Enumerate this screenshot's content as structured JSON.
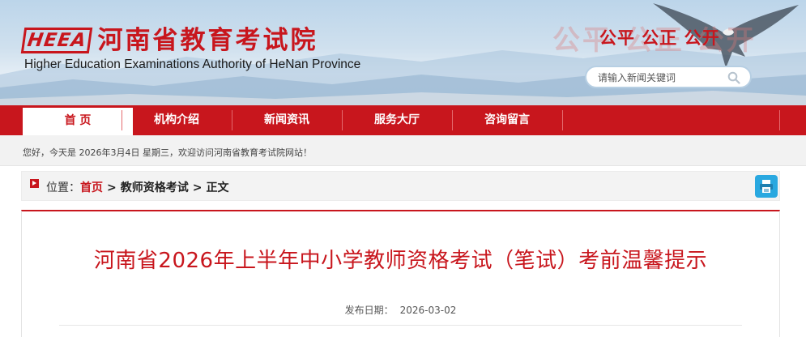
{
  "header": {
    "logo_mark": "HEEA",
    "title": "河南省教育考试院",
    "subtitle": "Higher Education Examinations Authority of HeNan Province",
    "slogan": "公平 公正 公开",
    "slogan_ghost": "公平 公正 公开"
  },
  "search": {
    "placeholder": "请输入新闻关键词",
    "icon": "search-icon"
  },
  "nav": {
    "items": [
      {
        "label": "首 页",
        "active": true
      },
      {
        "label": "机构介绍",
        "active": false
      },
      {
        "label": "新闻资讯",
        "active": false
      },
      {
        "label": "服务大厅",
        "active": false
      },
      {
        "label": "咨询留言",
        "active": false
      }
    ]
  },
  "welcome": {
    "text": "您好，今天是 2026年3月4日 星期三，欢迎访问河南省教育考试院网站！"
  },
  "breadcrumb": {
    "label": "位置：",
    "home": "首页",
    "sep": ">",
    "section": "教师资格考试",
    "current": "正文"
  },
  "print": {
    "icon": "print-icon"
  },
  "article": {
    "title": "河南省2026年上半年中小学教师资格考试（笔试）考前温馨提示",
    "date_label": "发布日期：",
    "date": "2026-03-02"
  },
  "colors": {
    "accent": "#c8161d",
    "print_button": "#29a8e0",
    "welcome_bg": "#f2f2f2"
  }
}
